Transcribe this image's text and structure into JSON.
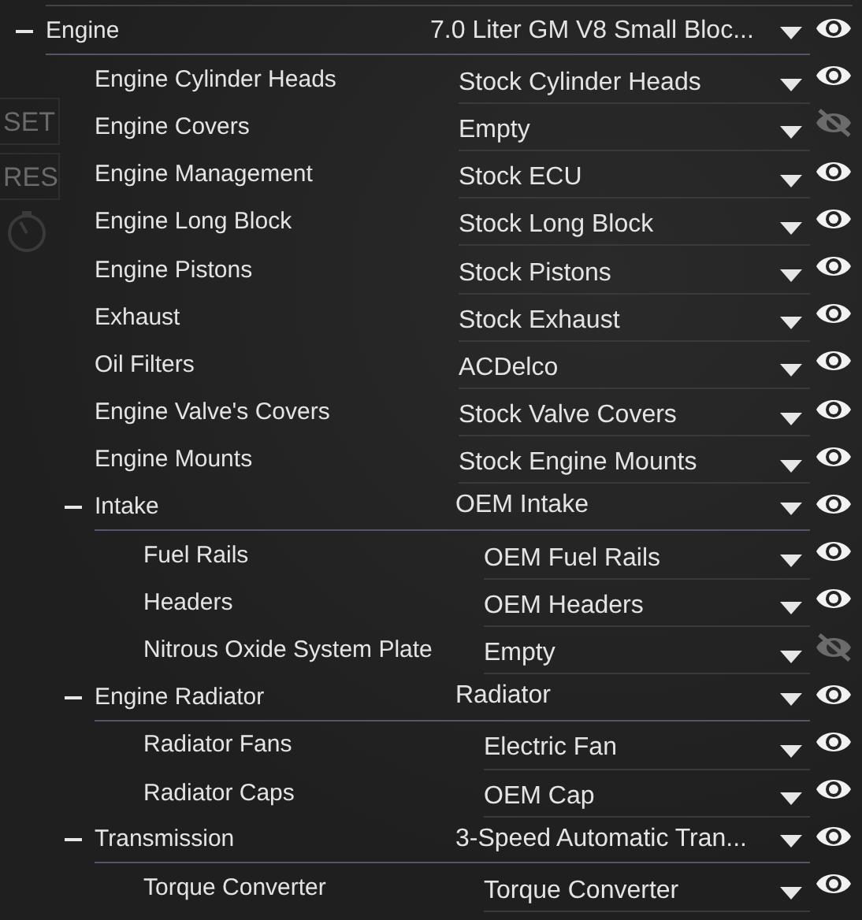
{
  "background_buttons": [
    {
      "label": "SET"
    },
    {
      "label": "RES"
    }
  ],
  "parts": [
    {
      "label": "Engine",
      "value": "7.0 Liter GM V8 Small Bloc...",
      "visible": true,
      "expanded": true,
      "children": [
        {
          "label": "Engine Cylinder Heads",
          "value": "Stock Cylinder Heads",
          "visible": true
        },
        {
          "label": "Engine Covers",
          "value": "Empty",
          "visible": false
        },
        {
          "label": "Engine Management",
          "value": "Stock ECU",
          "visible": true
        },
        {
          "label": "Engine Long Block",
          "value": "Stock Long Block",
          "visible": true
        },
        {
          "label": "Engine Pistons",
          "value": "Stock Pistons",
          "visible": true
        },
        {
          "label": "Exhaust",
          "value": "Stock Exhaust",
          "visible": true
        },
        {
          "label": "Oil Filters",
          "value": "ACDelco",
          "visible": true
        },
        {
          "label": "Engine Valve's Covers",
          "value": "Stock Valve Covers",
          "visible": true
        },
        {
          "label": "Engine Mounts",
          "value": "Stock Engine Mounts",
          "visible": true
        },
        {
          "label": "Intake",
          "value": "OEM Intake",
          "visible": true,
          "expanded": true,
          "children": [
            {
              "label": "Fuel Rails",
              "value": "OEM Fuel Rails",
              "visible": true
            },
            {
              "label": "Headers",
              "value": "OEM Headers",
              "visible": true
            },
            {
              "label": "Nitrous Oxide System Plate",
              "value": "Empty",
              "visible": false
            }
          ]
        },
        {
          "label": "Engine Radiator",
          "value": "Radiator",
          "visible": true,
          "expanded": true,
          "children": [
            {
              "label": "Radiator Fans",
              "value": "Electric Fan",
              "visible": true
            },
            {
              "label": "Radiator Caps",
              "value": "OEM Cap",
              "visible": true
            }
          ]
        },
        {
          "label": "Transmission",
          "value": "3-Speed Automatic Tran...",
          "visible": true,
          "expanded": true,
          "children": [
            {
              "label": "Torque Converter",
              "value": "Torque Converter",
              "visible": true
            }
          ]
        }
      ]
    }
  ]
}
